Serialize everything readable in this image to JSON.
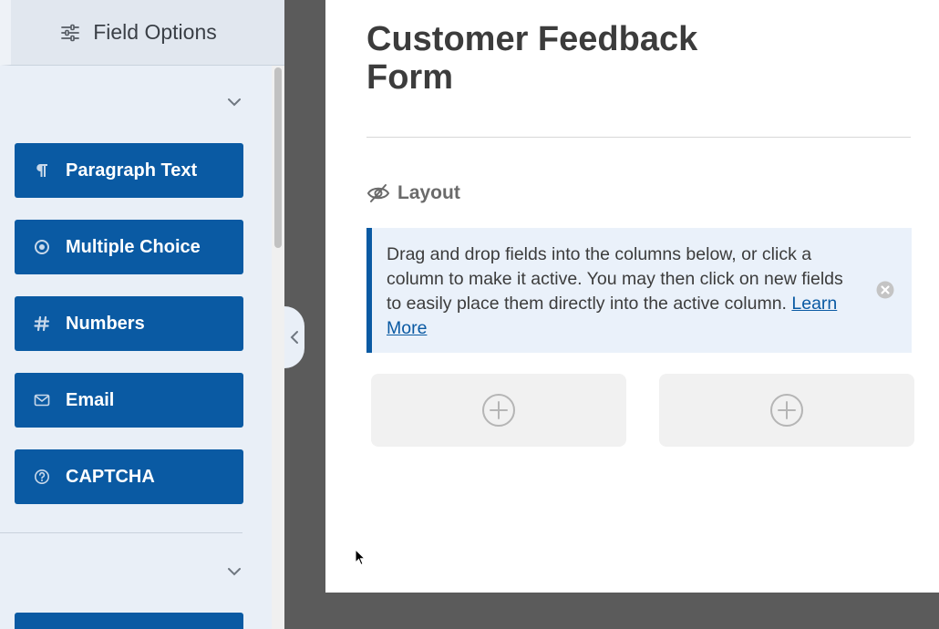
{
  "sidebar": {
    "tab_label": "Field Options",
    "fields": [
      {
        "label": "Paragraph Text",
        "icon": "paragraph-icon"
      },
      {
        "label": "Multiple Choice",
        "icon": "radio-icon"
      },
      {
        "label": "Numbers",
        "icon": "hash-icon"
      },
      {
        "label": "Email",
        "icon": "envelope-icon"
      },
      {
        "label": "CAPTCHA",
        "icon": "question-circle-icon"
      }
    ]
  },
  "form": {
    "title": "Customer Feedback Form"
  },
  "layout": {
    "label": "Layout",
    "notice_text": "Drag and drop fields into the columns below, or click a column to make it active. You may then click on new fields to easily place them directly into the active column.",
    "notice_link": "Learn More",
    "columns": 2
  },
  "colors": {
    "accent": "#0a5aa3",
    "sidebar_bg": "#e9eff7",
    "canvas_bg": "#ffffff",
    "backdrop": "#5b5b5b"
  }
}
